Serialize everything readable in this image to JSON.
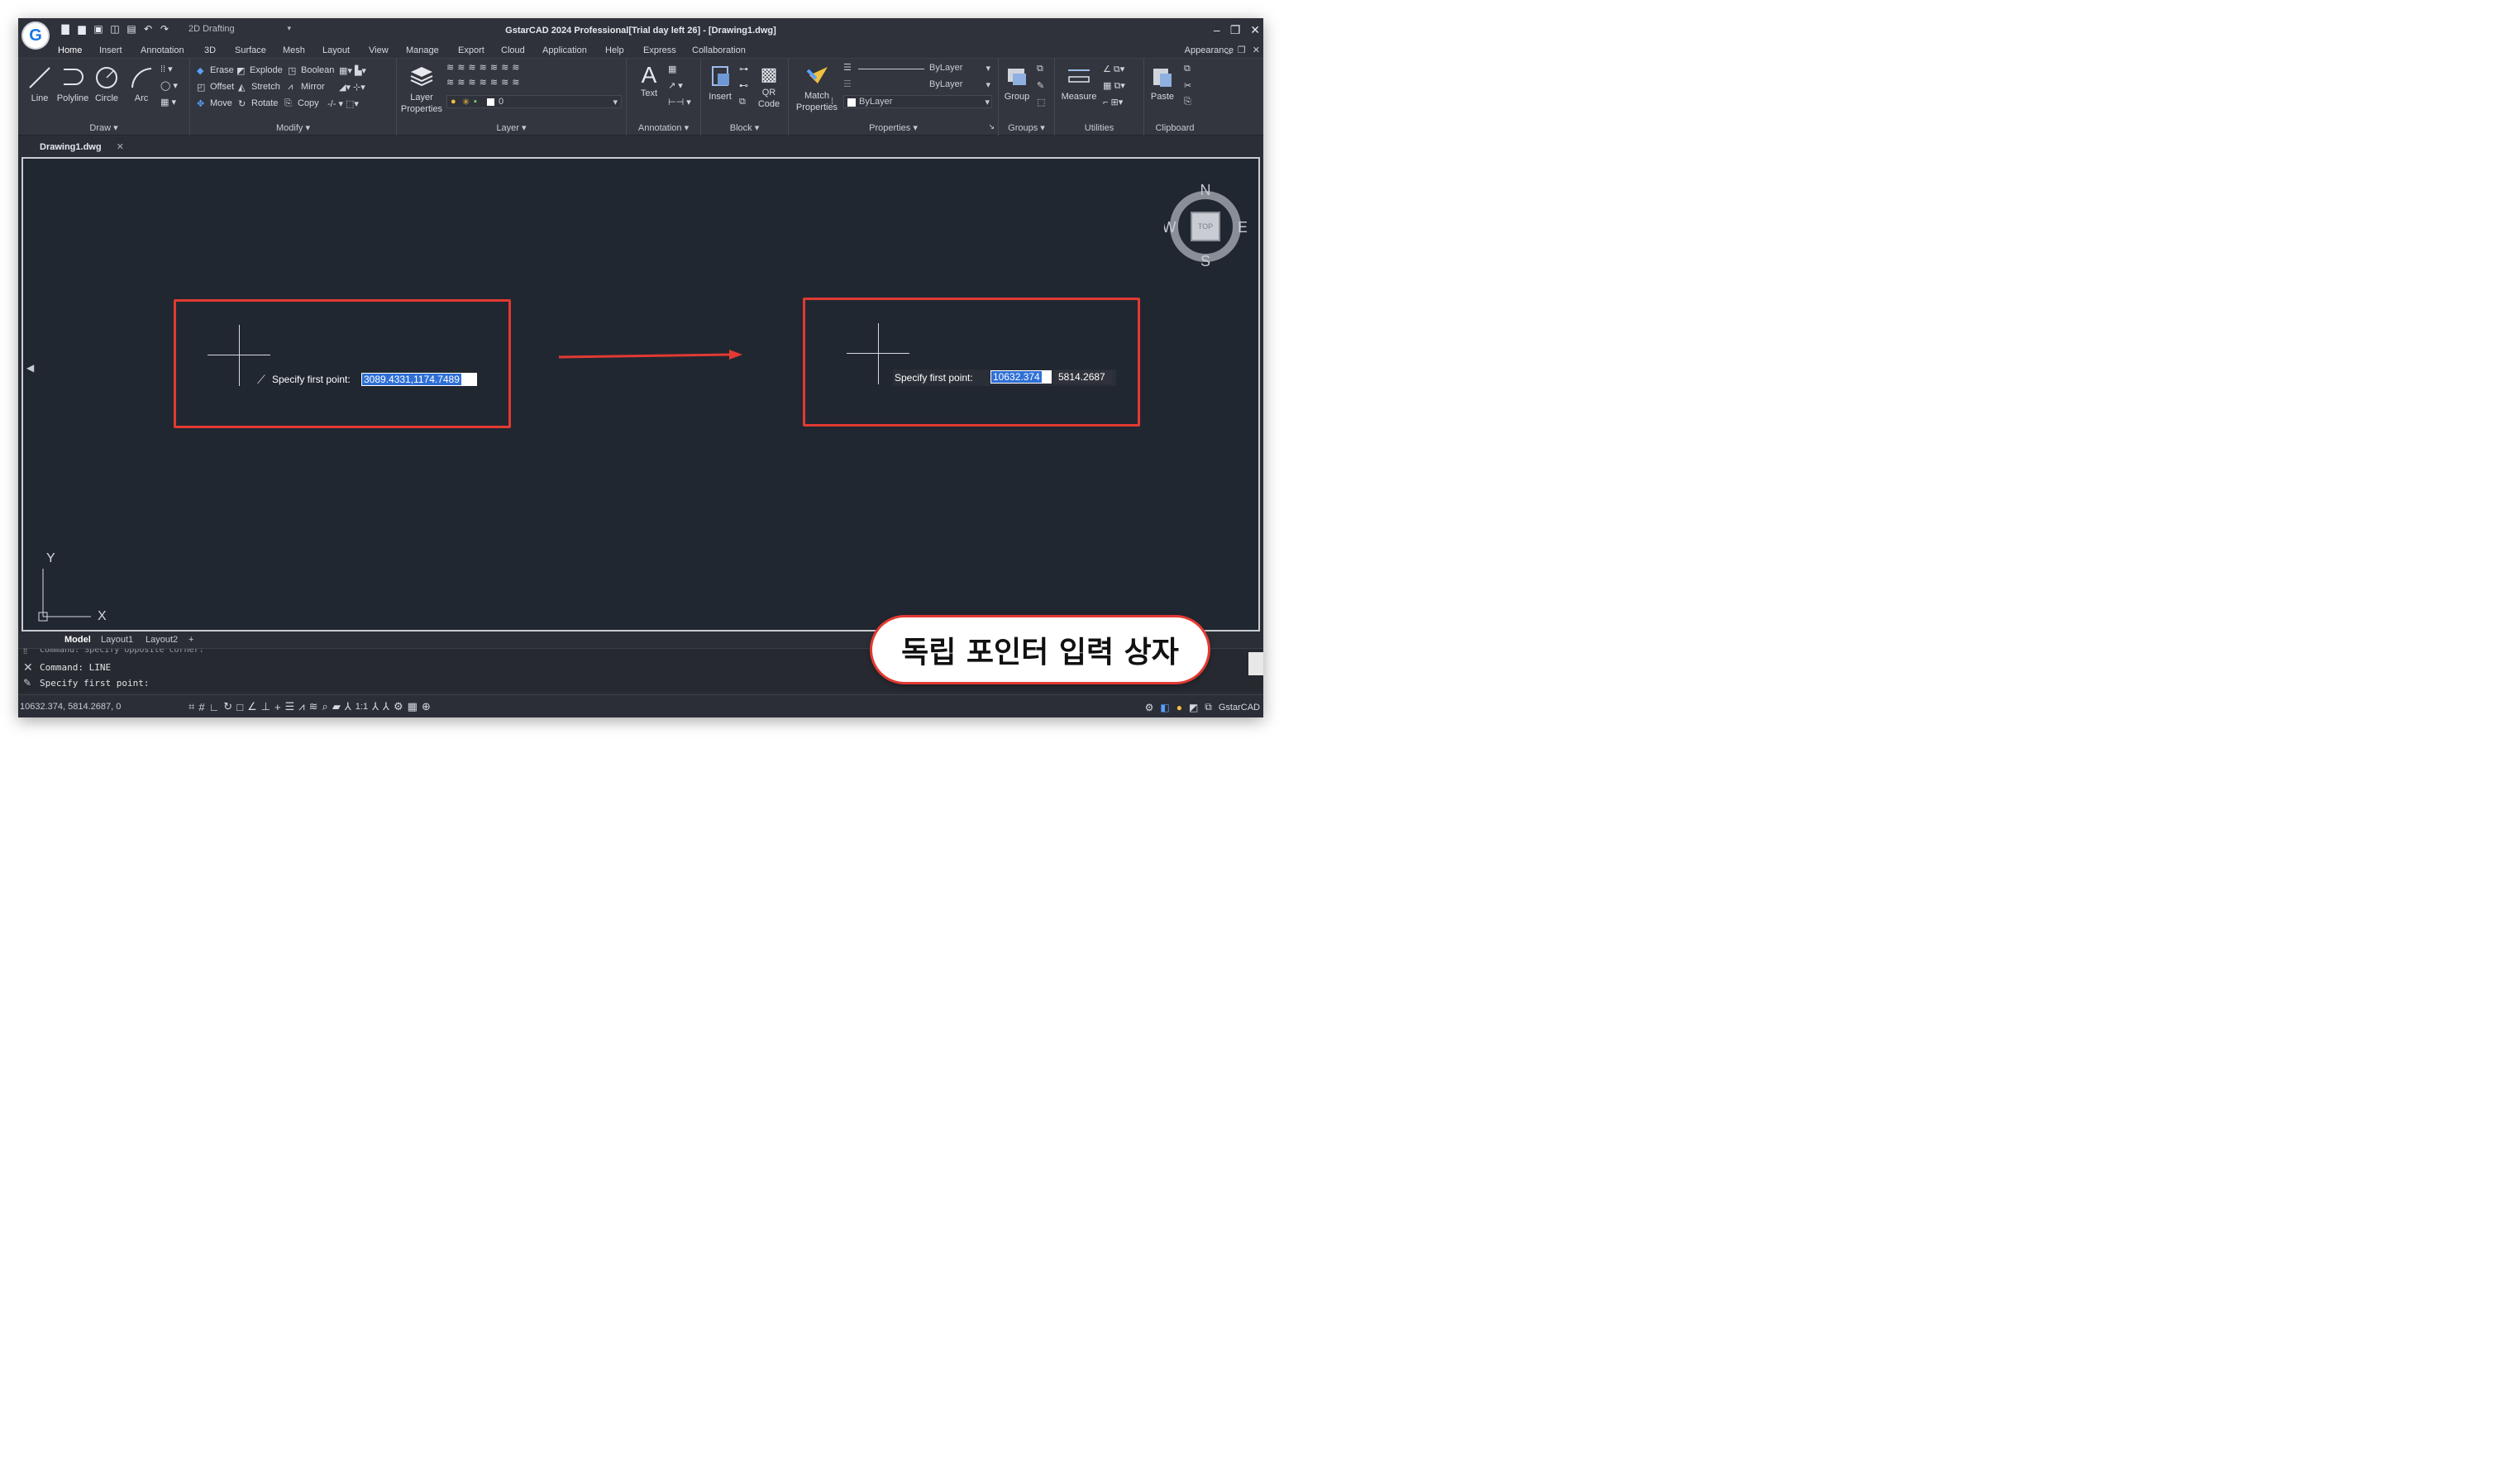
{
  "app": {
    "title": "GstarCAD 2024 Professional[Trial day left 26] - [Drawing1.dwg]",
    "workspace": "2D Drafting",
    "logo_letter": "G"
  },
  "menu": {
    "tabs": [
      "Home",
      "Insert",
      "Annotation",
      "3D",
      "Surface",
      "Mesh",
      "Layout",
      "View",
      "Manage",
      "Export",
      "Cloud",
      "Application",
      "Help",
      "Express",
      "Collaboration"
    ],
    "appearance": "Appearance"
  },
  "ribbon": {
    "draw": {
      "label": "Draw",
      "line": "Line",
      "polyline": "Polyline",
      "circle": "Circle",
      "arc": "Arc"
    },
    "modify": {
      "label": "Modify",
      "erase": "Erase",
      "explode": "Explode",
      "boolean": "Boolean",
      "offset": "Offset",
      "stretch": "Stretch",
      "mirror": "Mirror",
      "move": "Move",
      "rotate": "Rotate",
      "copy": "Copy"
    },
    "layer": {
      "label": "Layer",
      "properties": "Layer Properties",
      "current": "0"
    },
    "annotation": {
      "label": "Annotation",
      "text": "Text"
    },
    "block": {
      "label": "Block",
      "insert": "Insert",
      "qr": "QR Code"
    },
    "properties": {
      "label": "Properties",
      "match": "Match Properties",
      "color": "ByLayer",
      "linetype": "ByLayer",
      "lineweight": "ByLayer"
    },
    "groups": {
      "label": "Groups",
      "group": "Group"
    },
    "utilities": {
      "label": "Utilities",
      "measure": "Measure"
    },
    "clipboard": {
      "label": "Clipboard",
      "paste": "Paste"
    }
  },
  "document": {
    "tab": "Drawing1.dwg"
  },
  "canvas": {
    "before": {
      "prompt": "Specify first point:",
      "value": "3089.4331,1174.7489"
    },
    "after": {
      "prompt": "Specify first point:",
      "x_value": "10632.374",
      "y_value": "5814.2687"
    },
    "compass": {
      "n": "N",
      "s": "S",
      "e": "E",
      "w": "W",
      "top": "TOP"
    },
    "ucs": {
      "x": "X",
      "y": "Y"
    }
  },
  "layout_tabs": [
    "Model",
    "Layout1",
    "Layout2",
    "+"
  ],
  "command": {
    "line1": "Command: Specify opposite corner:",
    "line2": "Command: LINE",
    "line3": "Specify first point:"
  },
  "status": {
    "coords": "10632.374, 5814.2687, 0",
    "scale": "1:1",
    "brand": "GstarCAD"
  },
  "annotation_bubble": {
    "text": "독립 포인터 입력 상자"
  },
  "colors": {
    "accent_red": "#e23a32",
    "selection_blue": "#2f6fd6",
    "canvas_bg": "#212730"
  }
}
